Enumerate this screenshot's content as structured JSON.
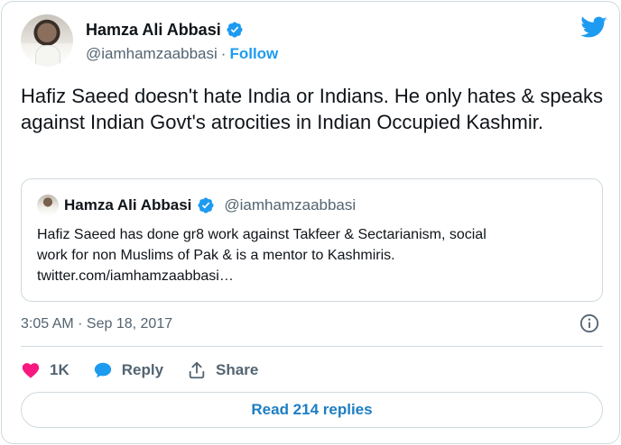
{
  "author": {
    "name": "Hamza Ali Abbasi",
    "handle": "@iamhamzaabbasi",
    "separator": "·",
    "follow_label": "Follow"
  },
  "tweet": {
    "text": "Hafiz Saeed doesn't hate India or Indians. He only hates & speaks against Indian Govt's atrocities in Indian Occupied Kashmir."
  },
  "quoted_tweet": {
    "name": "Hamza Ali Abbasi",
    "handle": "@iamhamzaabbasi",
    "text_line1": "Hafiz Saeed has done gr8 work against Takfeer & Sectarianism, social",
    "text_line2": "work for non Muslims of Pak & is a mentor to Kashmiris.",
    "text_line3": "twitter.com/iamhamzaabbasi…"
  },
  "meta": {
    "timestamp": "3:05 AM · Sep 18, 2017"
  },
  "actions": {
    "like_count": "1K",
    "reply_label": "Reply",
    "share_label": "Share"
  },
  "read_replies_label": "Read 214 replies",
  "colors": {
    "accent": "#1d9bf0",
    "like": "#f91880",
    "secondary_text": "#536471",
    "border": "#cfd9de"
  },
  "icons": [
    "verified-badge-icon",
    "twitter-bird-icon",
    "info-icon",
    "heart-icon",
    "reply-bubble-icon",
    "share-icon"
  ]
}
